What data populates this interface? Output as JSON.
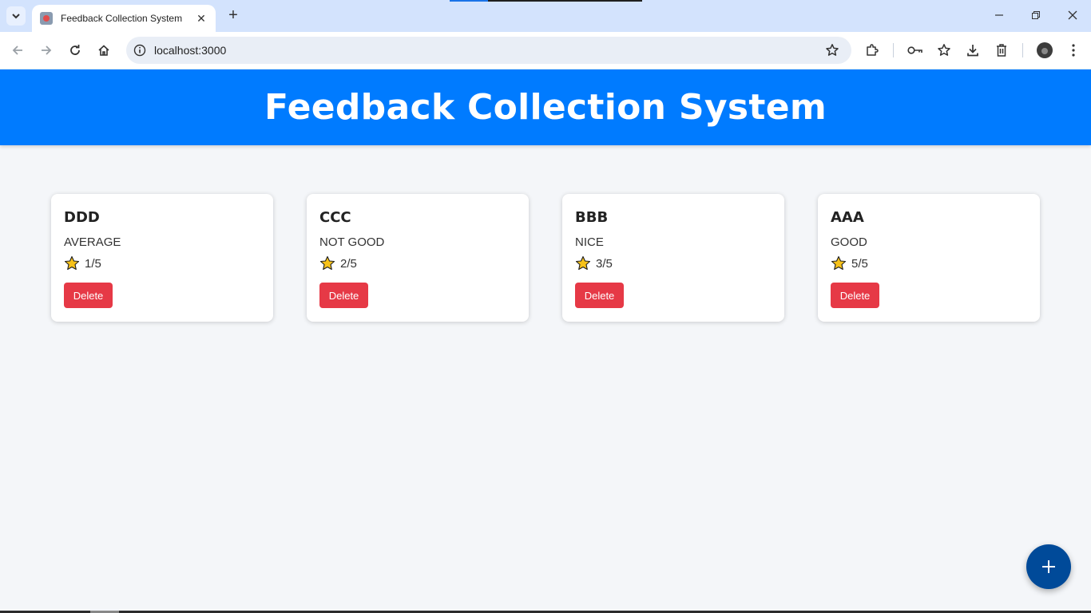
{
  "browser": {
    "tab_title": "Feedback Collection System",
    "url": "localhost:3000"
  },
  "app": {
    "title": "Feedback Collection System"
  },
  "feedback": [
    {
      "name": "DDD",
      "comment": "AVERAGE",
      "rating_text": "1/5",
      "rating": 1,
      "delete_label": "Delete"
    },
    {
      "name": "CCC",
      "comment": "NOT GOOD",
      "rating_text": "2/5",
      "rating": 2,
      "delete_label": "Delete"
    },
    {
      "name": "BBB",
      "comment": "NICE",
      "rating_text": "3/5",
      "rating": 3,
      "delete_label": "Delete"
    },
    {
      "name": "AAA",
      "comment": "GOOD",
      "rating_text": "5/5",
      "rating": 5,
      "delete_label": "Delete"
    }
  ],
  "colors": {
    "header": "#007bff",
    "delete": "#e63946",
    "fab": "#004a99",
    "star": "#f7c21a"
  },
  "icons": {
    "fab": "plus-icon",
    "rating": "star-icon"
  }
}
